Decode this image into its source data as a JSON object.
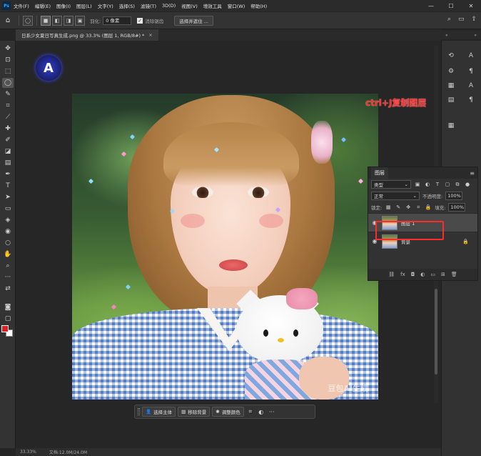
{
  "app": {
    "logo": "Ps"
  },
  "menu": [
    "文件(F)",
    "编辑(E)",
    "图像(I)",
    "图层(L)",
    "文字(Y)",
    "选择(S)",
    "滤镜(T)",
    "3D(D)",
    "视图(V)",
    "增效工具",
    "窗口(W)",
    "帮助(H)"
  ],
  "window_controls": {
    "minimize": "—",
    "maximize": "☐",
    "close": "✕"
  },
  "options": {
    "feather_label": "羽化:",
    "feather_value": "0 像素",
    "antialias_label": "消除锯齿",
    "select_mask_button": "选择并遮住 ..."
  },
  "document_tab": {
    "title": "日系少女夏日写真生成.png @ 33.3% (图层 1, RGB/8#) *",
    "close": "×"
  },
  "annotation": "ctrl+J复制图层",
  "photo_watermark": "豆包AI生成",
  "context_bar": {
    "select_subject": "选择主体",
    "remove_bg": "移除背景",
    "adjust_color": "调整颜色",
    "more": "···"
  },
  "status": {
    "zoom": "33.33%",
    "doc": "文档:12.0M/24.0M"
  },
  "layers_panel": {
    "tab": "图层",
    "filter_kind": "类型",
    "blend_mode": "正常",
    "opacity_label": "不透明度:",
    "opacity_value": "100%",
    "lock_label": "锁定:",
    "fill_label": "填充:",
    "fill_value": "100%",
    "layers": [
      {
        "name": "图层 1",
        "selected": true
      },
      {
        "name": "背景",
        "selected": false,
        "locked": true
      }
    ]
  },
  "colors": {
    "foreground": "#e02020",
    "background": "#ffffff",
    "annotation": "#ff2a2a",
    "highlight": "#ff2a2a"
  }
}
